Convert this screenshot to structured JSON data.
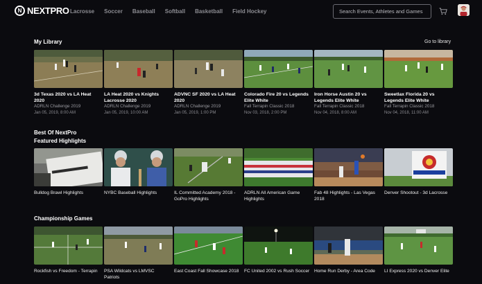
{
  "brand": {
    "name": "NEXTPRO"
  },
  "nav": [
    "Lacrosse",
    "Soccer",
    "Baseball",
    "Softball",
    "Basketball",
    "Field Hockey"
  ],
  "search": {
    "placeholder": "Search Events, Athletes and Games"
  },
  "library": {
    "title": "My Library",
    "link": "Go to library",
    "items": [
      {
        "title": "3d Texas 2020 vs LA Heat 2020",
        "event": "ADRLN Challenge 2019",
        "date": "Jan 05, 2019, 8:00 AM"
      },
      {
        "title": "LA Heat 2020 vs Knights Lacrosse 2020",
        "event": "ADRLN Challenge 2019",
        "date": "Jan 05, 2019, 10:00 AM"
      },
      {
        "title": "ADVNC SF 2020 vs LA Heat 2020",
        "event": "ADRLN Challenge 2019",
        "date": "Jan 05, 2019, 1:00 PM"
      },
      {
        "title": "Colorado Fire 20 vs Legends Elite White",
        "event": "Fall Terrapin Classic 2018",
        "date": "Nov 03, 2018, 2:00 PM"
      },
      {
        "title": "Iron Horse Austin 20 vs Legends Elite White",
        "event": "Fall Terrapin Classic 2018",
        "date": "Nov 04, 2018, 8:00 AM"
      },
      {
        "title": "Sweetlax Florida 20 vs Legends Elite White",
        "event": "Fall Terrapin Classic 2018",
        "date": "Nov 04, 2018, 11:00 AM"
      }
    ]
  },
  "best": {
    "title": "Best Of NextPro",
    "featured_title": "Featured Highlights",
    "items": [
      {
        "title": "Bulldog Brawl Highlights"
      },
      {
        "title": "NYBC Baseball Highlights"
      },
      {
        "title": "IL Committed Academy 2018 - GoPro Highlights"
      },
      {
        "title": "ADRLN All American Game Highlights"
      },
      {
        "title": "Fab 48 Highlights - Las Vegas 2018"
      },
      {
        "title": "Denver Shootout - 3d Lacrosse"
      }
    ]
  },
  "championship": {
    "title": "Championship Games",
    "items": [
      {
        "title": "Rockfish vs Freedom - Terrapin"
      },
      {
        "title": "PSA Wildcats vs LMVSC Patriots"
      },
      {
        "title": "East Coast Fall Showcase 2018"
      },
      {
        "title": "FC United 2002 vs Rush Soccer"
      },
      {
        "title": "Home Run Derby - Area Code"
      },
      {
        "title": "LI Express 2020 vs Denver Elite"
      }
    ]
  }
}
